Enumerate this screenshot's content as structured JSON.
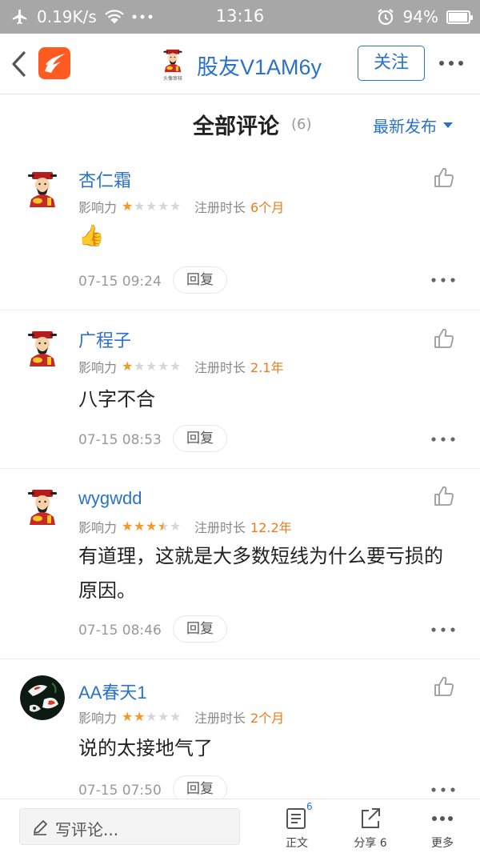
{
  "status_bar": {
    "speed": "0.19K/s",
    "time": "13:16",
    "battery": "94%",
    "battery_level": 0.94
  },
  "nav": {
    "title": "股友V1AM6y",
    "follow_label": "关注",
    "avatar_caption": "头像审核"
  },
  "section": {
    "title": "全部评论",
    "count": "(6)",
    "sort_label": "最新发布"
  },
  "labels": {
    "influence": "影响力",
    "registered": "注册时长",
    "reply": "回复"
  },
  "comments": [
    {
      "name": "杏仁霜",
      "stars": 1,
      "registered": "6个月",
      "text": "👍",
      "time": "07-15 09:24",
      "avatar": "god-of-wealth"
    },
    {
      "name": "广程子",
      "stars": 1,
      "registered": "2.1年",
      "text": "八字不合",
      "time": "07-15 08:53",
      "avatar": "god-of-wealth"
    },
    {
      "name": "wygwdd",
      "stars": 3.5,
      "registered": "12.2年",
      "text": "有道理，这就是大多数短线为什么要亏损的原因。",
      "time": "07-15 08:46",
      "avatar": "god-of-wealth"
    },
    {
      "name": "AA春天1",
      "stars": 2,
      "registered": "2个月",
      "text": "说的太接地气了",
      "time": "07-15 07:50",
      "avatar": "koi-fish"
    }
  ],
  "bottom_bar": {
    "write_placeholder": "写评论...",
    "article_label": "正文",
    "article_badge": "6",
    "share_label": "分享 6",
    "more_label": "更多"
  },
  "colors": {
    "accent": "#2a72c9",
    "star": "#f29a27",
    "registered_value": "#f07a1a",
    "status_bar": "#a7a7a7",
    "app_logo": "#ff5a1f"
  }
}
